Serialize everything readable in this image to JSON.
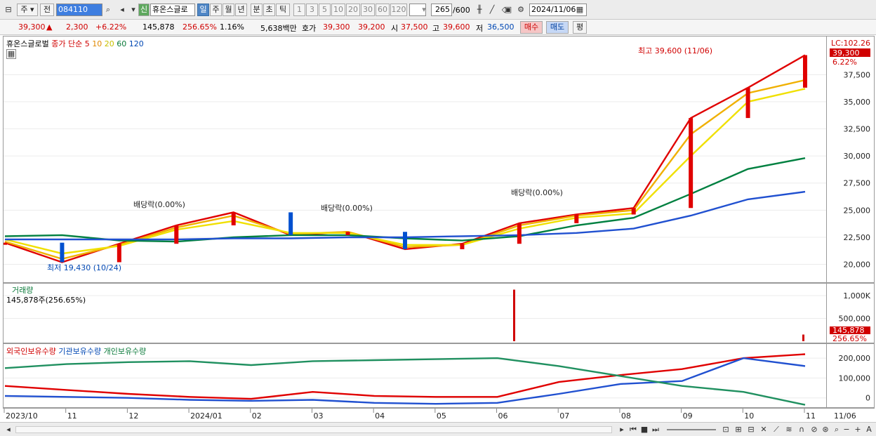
{
  "toolbar": {
    "type_select": "주",
    "prev_label": "전",
    "code": "084110",
    "new_badge": "신",
    "stock_name": "휴온스글로",
    "periods": [
      "일",
      "주",
      "월",
      "년",
      "분",
      "초",
      "틱"
    ],
    "minutes": [
      "1",
      "3",
      "5",
      "10",
      "20",
      "30",
      "60",
      "120"
    ],
    "count": "265",
    "count_total": "/600",
    "date": "2024/11/06"
  },
  "quote": {
    "price": "39,300",
    "arrow": "▲",
    "change": "2,300",
    "change_pct": "+6.22%",
    "volume": "145,878",
    "vol_ratio": "256.65%",
    "turnover_pct": "1.16%",
    "amount": "5,638백만",
    "hoga_label": "호가",
    "ask": "39,300",
    "bid": "39,200",
    "open_label": "시",
    "open": "37,500",
    "high_label": "고",
    "high": "39,600",
    "low_label": "저",
    "low": "36,500",
    "buy_label": "매수",
    "sell_label": "매도",
    "eval_label": "평"
  },
  "legend": {
    "name": "휴온스글로벌",
    "ma_title": "종가 단순",
    "ma_periods": [
      "5",
      "10",
      "20",
      "60",
      "120"
    ],
    "ma_colors": [
      "#e00000",
      "#f0b000",
      "#f0e000",
      "#008040",
      "#2050d0"
    ],
    "volume_title": "거래량",
    "volume_value": "145,878주(256.65%)",
    "flow_items": [
      "외국인보유수량",
      "기관보유수량",
      "개인보유수량"
    ],
    "flow_colors": [
      "#e00000",
      "#2050d0",
      "#209060"
    ]
  },
  "annotations": {
    "high": "최고 39,600 (11/06)",
    "low": "최저 19,430 (10/24)",
    "dividends": [
      "배당락(0.00%)",
      "배당락(0.00%)",
      "배당락(0.00%)"
    ],
    "lc": "LC:102.26",
    "price_tag": "39,300",
    "pct_tag": "6.22%",
    "vol_tag": "145,878",
    "vol_pct_tag": "256.65%"
  },
  "chart_data": [
    {
      "type": "line",
      "title": "휴온스글로벌",
      "x": [
        "2023/10",
        "11",
        "12",
        "2024/01",
        "02",
        "03",
        "04",
        "05",
        "06",
        "07",
        "08",
        "09",
        "10",
        "11",
        "11/06"
      ],
      "y_ticks": [
        "37,500",
        "35,000",
        "32,500",
        "30,000",
        "27,500",
        "25,000",
        "22,500",
        "20,000"
      ],
      "ylim": [
        19000,
        40500
      ],
      "series": [
        {
          "name": "5",
          "values": [
            22000,
            20200,
            21900,
            23600,
            24800,
            22700,
            23000,
            21400,
            21900,
            23800,
            24600,
            25200,
            33500,
            36300,
            39300
          ]
        },
        {
          "name": "10",
          "values": [
            22100,
            20500,
            21800,
            23400,
            24500,
            22800,
            23000,
            21600,
            21800,
            23600,
            24500,
            25000,
            32000,
            35800,
            37000
          ]
        },
        {
          "name": "20",
          "values": [
            22300,
            21000,
            21700,
            23200,
            24000,
            22900,
            22900,
            21800,
            21800,
            23300,
            24300,
            24700,
            30000,
            35000,
            36200
          ]
        },
        {
          "name": "60",
          "values": [
            22600,
            22700,
            22200,
            22100,
            22500,
            22700,
            22700,
            22400,
            22200,
            22600,
            23600,
            24300,
            26500,
            28800,
            29800
          ]
        },
        {
          "name": "120",
          "values": [
            22300,
            22300,
            22300,
            22300,
            22400,
            22400,
            22500,
            22500,
            22600,
            22700,
            22900,
            23300,
            24500,
            26000,
            26700
          ]
        }
      ]
    },
    {
      "type": "bar",
      "title": "거래량",
      "y_ticks": [
        "1,000K",
        "500,000"
      ],
      "ylim": [
        0,
        1200000
      ],
      "spike": {
        "x": "06",
        "value": 1130000
      },
      "last": 145878
    },
    {
      "type": "line",
      "y_ticks": [
        "200,000",
        "100,000",
        "0"
      ],
      "ylim": [
        -40000,
        250000
      ],
      "x": [
        "2023/10",
        "11",
        "12",
        "2024/01",
        "02",
        "03",
        "04",
        "05",
        "06",
        "07",
        "08",
        "09",
        "10",
        "11"
      ],
      "series": [
        {
          "name": "외국인보유수량",
          "values": [
            60000,
            40000,
            20000,
            5000,
            -5000,
            30000,
            10000,
            5000,
            5000,
            80000,
            115000,
            145000,
            200000,
            220000
          ]
        },
        {
          "name": "기관보유수량",
          "values": [
            10000,
            5000,
            0,
            -10000,
            -15000,
            -10000,
            -25000,
            -30000,
            -25000,
            20000,
            70000,
            85000,
            200000,
            160000
          ]
        },
        {
          "name": "개인보유수량",
          "values": [
            150000,
            170000,
            180000,
            185000,
            165000,
            185000,
            190000,
            195000,
            200000,
            160000,
            110000,
            60000,
            30000,
            -35000
          ]
        }
      ]
    }
  ]
}
